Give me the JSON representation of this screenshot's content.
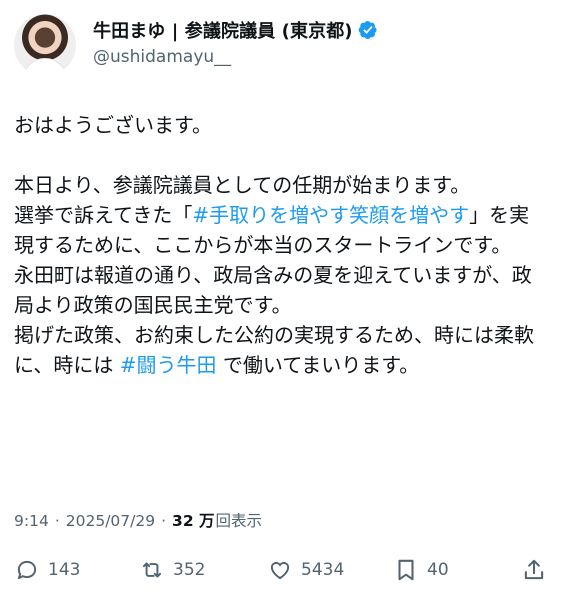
{
  "user": {
    "display_name": "牛田まゆ | 参議院議員 (東京都)",
    "handle": "@ushidamayu__"
  },
  "tweet": {
    "greeting": "おはようございます。",
    "line1": "本日より、参議院議員としての任期が始まります。",
    "line2_pre": "選挙で訴えてきた「",
    "hashtag1": "#手取りを増やす笑顔を増やす",
    "line2_post": "」を実現するために、ここからが本当のスタートラインです。",
    "line3": "永田町は報道の通り、政局含みの夏を迎えていますが、政局より政策の国民民主党です。",
    "line4_pre": "掲げた政策、お約束した公約の実現するため、時には柔軟に、時には ",
    "hashtag2": "#闘う牛田",
    "line4_post": " で働いてまいります。"
  },
  "meta": {
    "time": "9:14",
    "date": "2025/07/29",
    "views_count": "32 万",
    "views_label": "回表示"
  },
  "actions": {
    "replies": "143",
    "reposts": "352",
    "likes": "5434",
    "bookmarks": "40"
  },
  "colors": {
    "text": "#0f1419",
    "secondary": "#536471",
    "link": "#1d9bf0",
    "verified": "#1d9bf0"
  },
  "icons": [
    "verified-badge-icon",
    "reply-icon",
    "repost-icon",
    "like-icon",
    "bookmark-icon",
    "share-icon"
  ]
}
